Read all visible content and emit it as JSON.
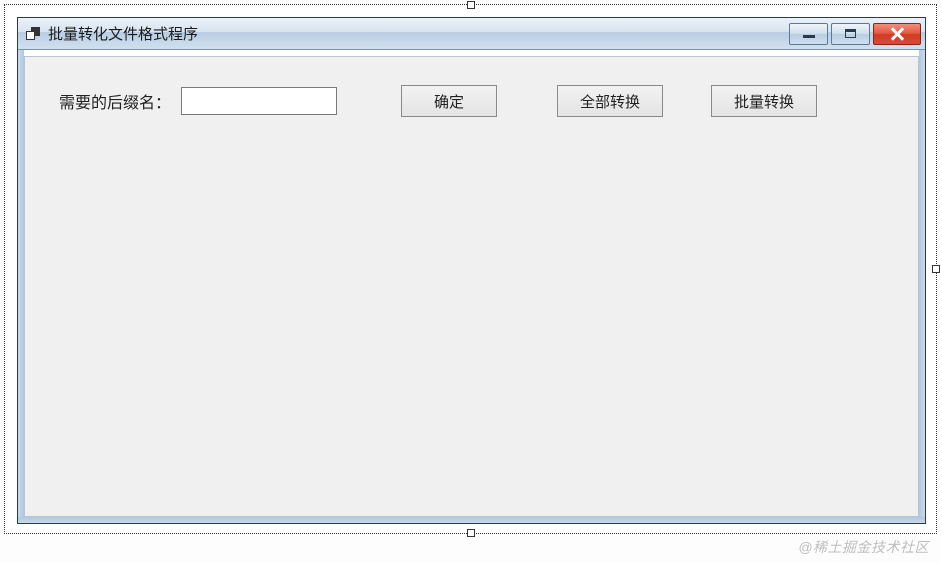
{
  "window": {
    "title": "批量转化文件格式程序"
  },
  "form": {
    "extension_label": "需要的后缀名：",
    "extension_value": ""
  },
  "buttons": {
    "confirm": "确定",
    "convert_all": "全部转换",
    "convert_batch": "批量转换"
  },
  "watermark": "@稀土掘金技术社区"
}
